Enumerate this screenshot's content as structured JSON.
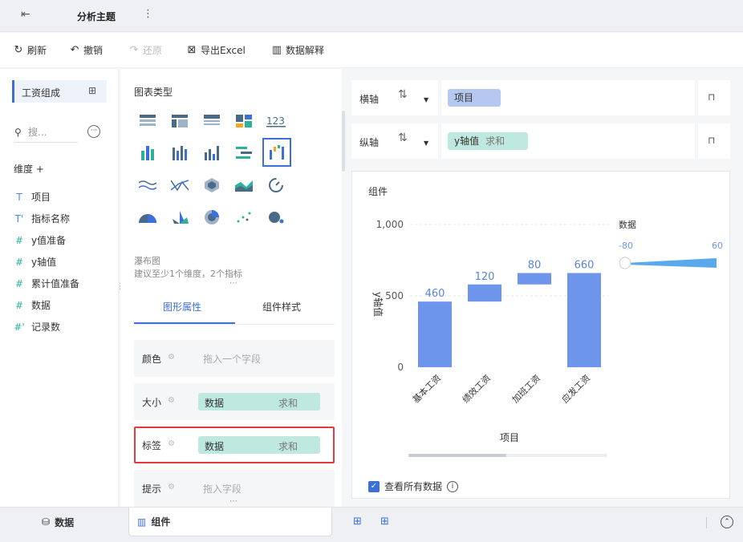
{
  "topbar": {
    "title": "分析主题"
  },
  "toolbar": {
    "refresh": "刷新",
    "undo": "撤销",
    "redo": "还原",
    "export": "导出Excel",
    "explain": "数据解释"
  },
  "left": {
    "tab_label": "工资组成",
    "search_placeholder": "搜...",
    "dim_header": "维度 +",
    "fields": [
      {
        "icon": "T",
        "name": "项目"
      },
      {
        "icon": "T'",
        "name": "指标名称"
      },
      {
        "icon": "#",
        "name": "y值准备"
      },
      {
        "icon": "#",
        "name": "y轴值"
      },
      {
        "icon": "#",
        "name": "累计值准备"
      },
      {
        "icon": "#",
        "name": "数据"
      },
      {
        "icon": "#'",
        "name": "记录数"
      }
    ]
  },
  "middle": {
    "chart_type_title": "图表类型",
    "chart_name": "瀑布图",
    "chart_hint": "建议至少1个维度，2个指标",
    "tabs": {
      "shape_props": "图形属性",
      "component_style": "组件样式"
    },
    "props": {
      "color": {
        "label": "颜色",
        "placeholder": "拖入一个字段"
      },
      "size": {
        "label": "大小",
        "field": "数据",
        "agg": "求和"
      },
      "tag": {
        "label": "标签",
        "field": "数据",
        "agg": "求和"
      },
      "tip": {
        "label": "提示",
        "placeholder": "拖入字段"
      }
    }
  },
  "right": {
    "x_axis": {
      "label": "横轴",
      "field": "项目"
    },
    "y_axis": {
      "label": "纵轴",
      "field": "y轴值",
      "agg": "求和"
    },
    "component_title": "组件",
    "see_all": "查看所有数据",
    "legend_title": "数据",
    "legend_min": "-80",
    "legend_max": "60"
  },
  "chart_data": {
    "type": "bar",
    "subtype": "waterfall",
    "categories": [
      "基本工资",
      "绩效工资",
      "加班工资",
      "应发工资"
    ],
    "values": [
      460,
      120,
      80,
      660
    ],
    "bases": [
      0,
      460,
      580,
      0
    ],
    "xlabel": "项目",
    "ylabel": "y轴值",
    "ylim": [
      0,
      1000
    ],
    "yticks": [
      "0",
      "500",
      "1,000"
    ],
    "bar_color": "#6d95eb"
  },
  "bottom": {
    "data_tab": "数据",
    "component_tab": "组件"
  },
  "colors": {
    "accent": "#3b6fd9",
    "chip_teal": "#bfe8e0",
    "chip_blue": "#b5c9f0",
    "highlight": "#e4393c"
  }
}
